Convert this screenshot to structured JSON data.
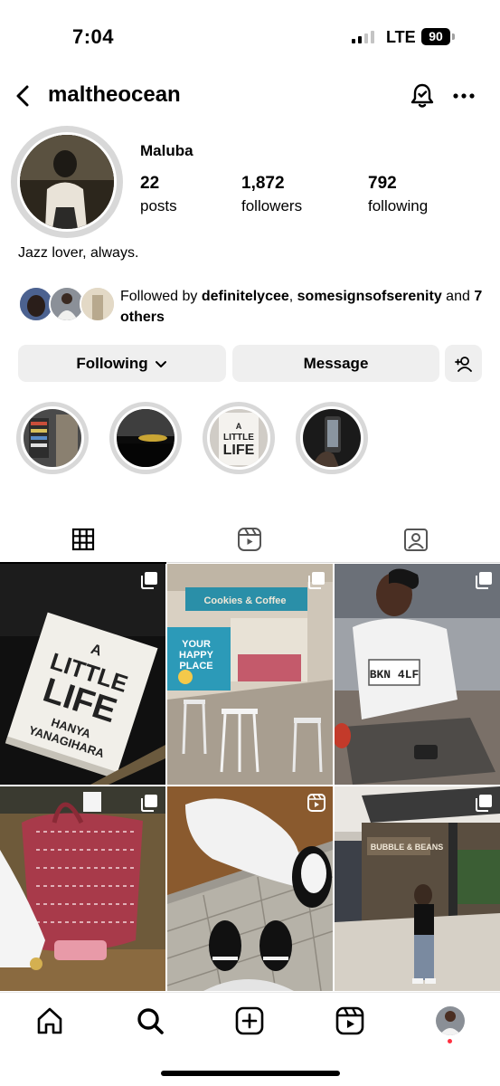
{
  "status_bar": {
    "time": "7:04",
    "network": "LTE",
    "battery": "90",
    "signal_bars_filled": 2,
    "signal_bars_total": 4
  },
  "header": {
    "username": "maltheocean",
    "icons": [
      "chevron-left-icon",
      "bell-check-icon",
      "more-horizontal-icon"
    ]
  },
  "profile": {
    "display_name": "Maluba",
    "stats": [
      {
        "value": "22",
        "label": "posts"
      },
      {
        "value": "1,872",
        "label": "followers"
      },
      {
        "value": "792",
        "label": "following"
      }
    ],
    "bio": "Jazz lover, always.",
    "followed_by": {
      "prefix": "Followed by ",
      "user1": "definitelycee",
      "sep": ", ",
      "user2": "somesignsofserenity",
      "and": " and ",
      "others": "7 others"
    }
  },
  "actions": {
    "following_label": "Following",
    "message_label": "Message"
  },
  "highlights": [
    {
      "name": "highlight-store"
    },
    {
      "name": "highlight-car"
    },
    {
      "name": "highlight-book"
    },
    {
      "name": "highlight-phone"
    }
  ],
  "tabs": [
    {
      "name": "grid-icon",
      "active": true
    },
    {
      "name": "reels-icon",
      "active": false
    },
    {
      "name": "tagged-icon",
      "active": false
    }
  ],
  "posts": [
    {
      "book_title": [
        "A",
        "LITTLE",
        "LIFE"
      ],
      "book_author": [
        "HANYA",
        "YANAGIHARA"
      ],
      "badge": "carousel"
    },
    {
      "sign": "Cookies & Coffee",
      "wall_text": [
        "YOUR",
        "HAPPY",
        "PLACE"
      ],
      "badge": "carousel"
    },
    {
      "shirt_text": "BKN 4LF",
      "badge": "carousel"
    },
    {
      "badge": "carousel"
    },
    {
      "badge": "reel"
    },
    {
      "storefront": "BUBBLE & BEANS",
      "badge": "carousel"
    }
  ],
  "bottom_nav": [
    "home-icon",
    "search-icon",
    "new-post-icon",
    "reels-icon",
    "profile-avatar"
  ],
  "colors": {
    "button_bg": "#efefef",
    "notification_dot": "#ff3040",
    "divider": "#dbdbdb"
  }
}
